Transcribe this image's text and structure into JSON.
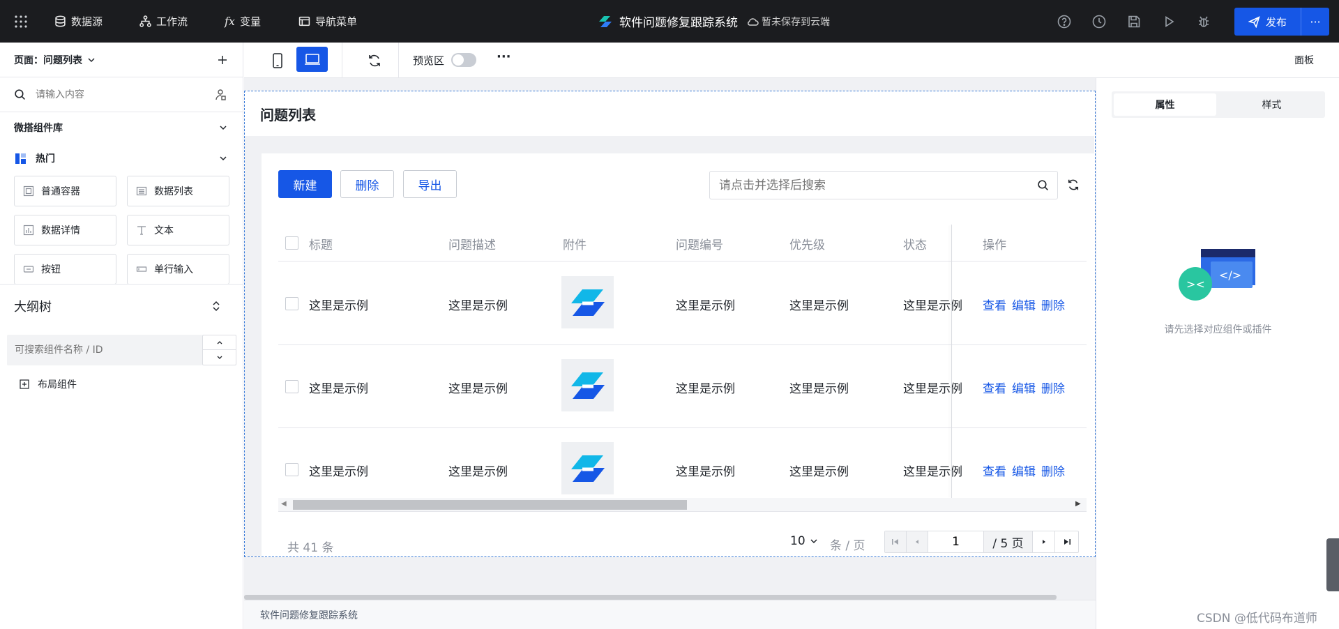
{
  "topbar": {
    "nav": [
      {
        "label": "数据源",
        "icon": "database-icon"
      },
      {
        "label": "工作流",
        "icon": "workflow-icon"
      },
      {
        "label": "变量",
        "icon": "fx-icon"
      },
      {
        "label": "导航菜单",
        "icon": "nav-menu-icon"
      }
    ],
    "app_title": "软件问题修复跟踪系统",
    "save_status": "暂未保存到云端",
    "publish_label": "发布",
    "publish_more": "···"
  },
  "left": {
    "page_selector": "页面：问题列表",
    "search_placeholder": "请输入内容",
    "library_title": "微搭组件库",
    "hot_group": "热门",
    "components": [
      {
        "label": "普通容器",
        "icon": "container-icon"
      },
      {
        "label": "数据列表",
        "icon": "data-list-icon"
      },
      {
        "label": "数据详情",
        "icon": "data-detail-icon"
      },
      {
        "label": "文本",
        "icon": "text-icon"
      },
      {
        "label": "按钮",
        "icon": "button-icon"
      },
      {
        "label": "单行输入",
        "icon": "single-input-icon"
      }
    ],
    "outline_title": "大纲树",
    "outline_search_placeholder": "可搜索组件名称 / ID",
    "outline_root": "布局组件"
  },
  "toolbar": {
    "preview_label": "预览区",
    "panel_label": "面板",
    "more": "···"
  },
  "canvas": {
    "page_title": "问题列表",
    "buttons": {
      "new": "新建",
      "delete": "删除",
      "export": "导出"
    },
    "search_placeholder": "请点击并选择后搜索",
    "columns": [
      "标题",
      "问题描述",
      "附件",
      "问题编号",
      "优先级",
      "状态",
      "操作"
    ],
    "rows": [
      {
        "title": "这里是示例",
        "desc": "这里是示例",
        "code": "这里是示例",
        "priority": "这里是示例",
        "status": "这里是示例"
      },
      {
        "title": "这里是示例",
        "desc": "这里是示例",
        "code": "这里是示例",
        "priority": "这里是示例",
        "status": "这里是示例"
      },
      {
        "title": "这里是示例",
        "desc": "这里是示例",
        "code": "这里是示例",
        "priority": "这里是示例",
        "status": "这里是示例"
      }
    ],
    "actions": {
      "view": "查看",
      "edit": "编辑",
      "delete": "删除"
    },
    "pagination": {
      "total": "共 41 条",
      "page_size": "10",
      "per_page_unit": "条 / 页",
      "current_page": "1",
      "total_pages": "/ 5 页"
    },
    "footer": "软件问题修复跟踪系统"
  },
  "right": {
    "tabs": [
      "属性",
      "样式"
    ],
    "empty_hint": "请先选择对应组件或插件"
  },
  "watermark": "CSDN @低代码布道师",
  "colors": {
    "primary": "#1657e6",
    "topbar": "#1b1c1f",
    "canvas_bg": "#f0f1f4",
    "frame_border": "#3a7bd8"
  }
}
